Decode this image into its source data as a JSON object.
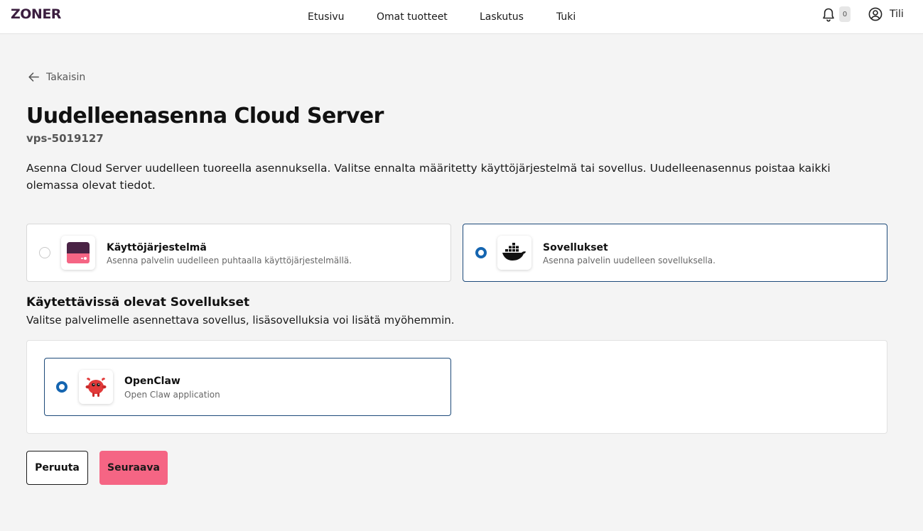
{
  "header": {
    "logo": "ZONER",
    "nav": [
      "Etusivu",
      "Omat tuotteet",
      "Laskutus",
      "Tuki"
    ],
    "notification_count": "0",
    "account_label": "Tili"
  },
  "page": {
    "back_label": "Takaisin",
    "title": "Uudelleenasenna Cloud Server",
    "server_id": "vps-5019127",
    "description": "Asenna Cloud Server uudelleen tuoreella asennuksella. Valitse ennalta määritetty käyttöjärjestelmä tai sovellus. Uudelleenasennus poistaa kaikki olemassa olevat tiedot."
  },
  "install_types": [
    {
      "title": "Käyttöjärjestelmä",
      "subtitle": "Asenna palvelin uudelleen puhtaalla käyttöjärjestelmällä.",
      "icon": "os-icon",
      "selected": false
    },
    {
      "title": "Sovellukset",
      "subtitle": "Asenna palvelin uudelleen sovelluksella.",
      "icon": "docker-icon",
      "selected": true
    }
  ],
  "apps_section": {
    "title": "Käytettävissä olevat Sovellukset",
    "subtitle": "Valitse palvelimelle asennettava sovellus, lisäsovelluksia voi lisätä myöhemmin.",
    "apps": [
      {
        "title": "OpenClaw",
        "subtitle": "Open Claw application",
        "icon": "openclaw-icon",
        "selected": true
      }
    ]
  },
  "actions": {
    "cancel": "Peruuta",
    "next": "Seuraava"
  },
  "colors": {
    "brand": "#3b1e3f",
    "primary_button": "#f56584",
    "radio_selected": "#1565b0",
    "card_selected_border": "#1d4a7a"
  }
}
